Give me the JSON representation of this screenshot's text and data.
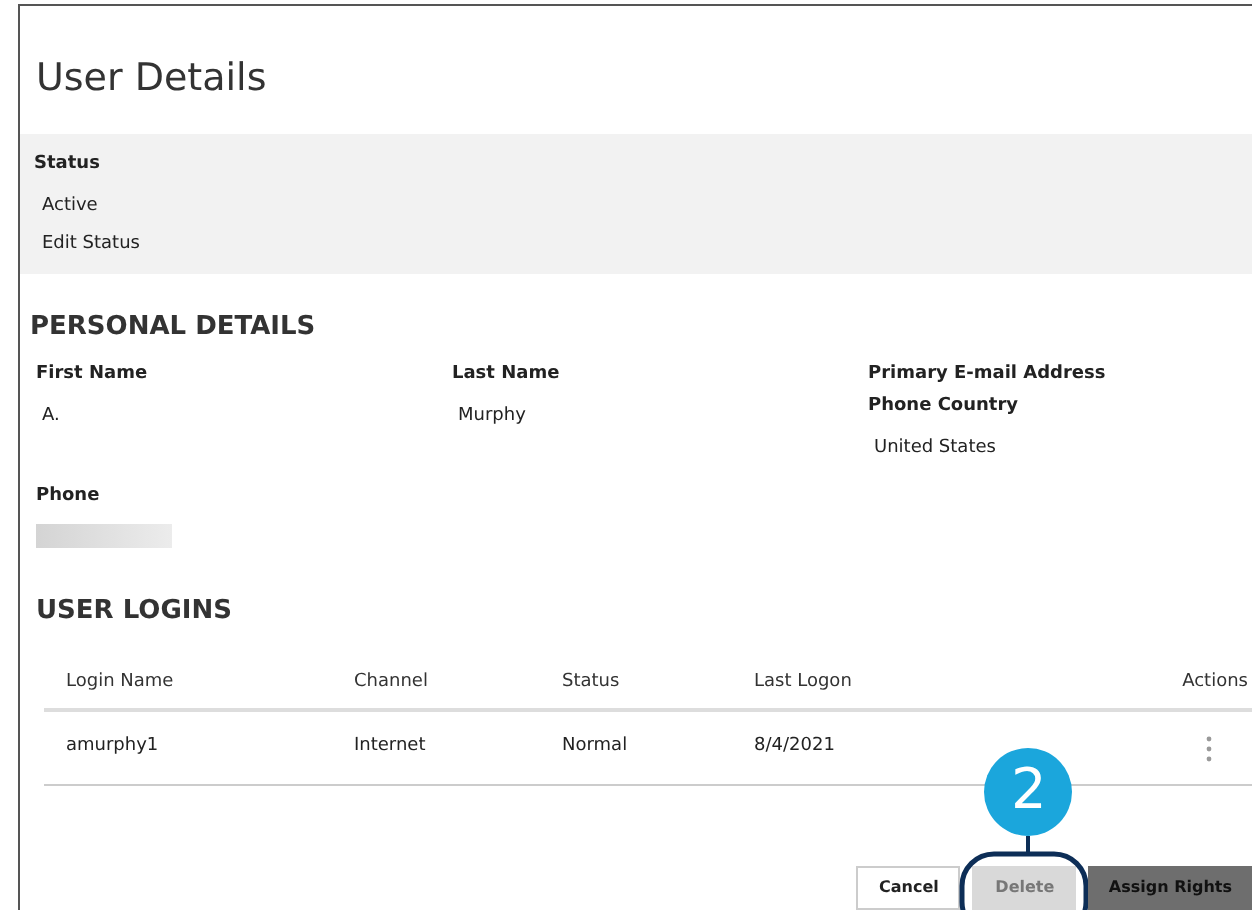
{
  "title": "User Details",
  "status": {
    "label": "Status",
    "value": "Active",
    "link": "Edit Status"
  },
  "personal_details": {
    "heading": "PERSONAL DETAILS",
    "fields": [
      {
        "label": "First Name",
        "value": "A."
      },
      {
        "label": "Last Name",
        "value": "Murphy"
      },
      {
        "label": "Primary E-mail Address"
      },
      {
        "label": "Phone Country",
        "value": "United States"
      }
    ],
    "phone": {
      "label": "Phone",
      "redacted": true
    }
  },
  "user_logins": {
    "heading": "USER LOGINS",
    "columns": [
      "Login Name",
      "Channel",
      "Status",
      "Last Logon",
      "Actions"
    ],
    "rows": [
      {
        "cells": [
          "amurphy1",
          "Internet",
          "Normal",
          "8/4/2021"
        ]
      }
    ]
  },
  "buttons": [
    {
      "label": "Cancel",
      "kind": "outline",
      "disabled": false
    },
    {
      "label": "Delete",
      "kind": "outline",
      "disabled": true
    },
    {
      "label": "Assign Rights",
      "kind": "dark",
      "disabled": false
    }
  ],
  "callout": {
    "number": "2"
  }
}
